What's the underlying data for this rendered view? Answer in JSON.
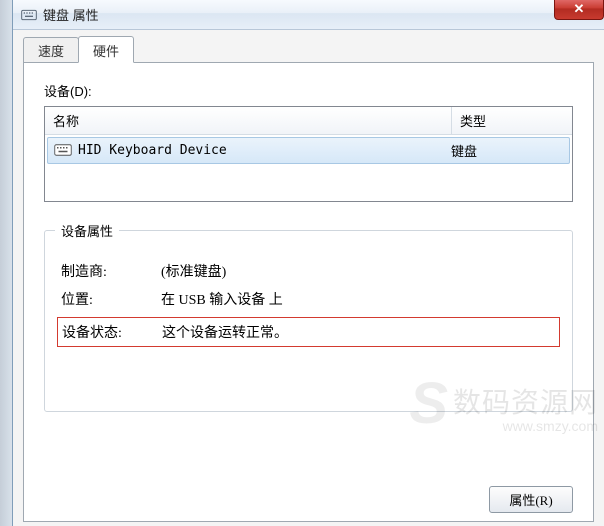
{
  "window": {
    "title": "键盘 属性",
    "close_glyph": "✕"
  },
  "tabs": [
    {
      "label": "速度",
      "active": false
    },
    {
      "label": "硬件",
      "active": true
    }
  ],
  "devices": {
    "label": "设备(D):",
    "columns": {
      "name": "名称",
      "type": "类型"
    },
    "rows": [
      {
        "name": "HID Keyboard Device",
        "type": "键盘"
      }
    ]
  },
  "properties_group": {
    "title": "设备属性",
    "manufacturer_label": "制造商:",
    "manufacturer_value": "(标准键盘)",
    "location_label": "位置:",
    "location_value": "在 USB 输入设备 上",
    "status_label": "设备状态:",
    "status_value": "这个设备运转正常。"
  },
  "buttons": {
    "properties": "属性(R)"
  },
  "watermark": {
    "line1": "数码资源网",
    "line2": "www.smzy.com",
    "logo": "S"
  }
}
